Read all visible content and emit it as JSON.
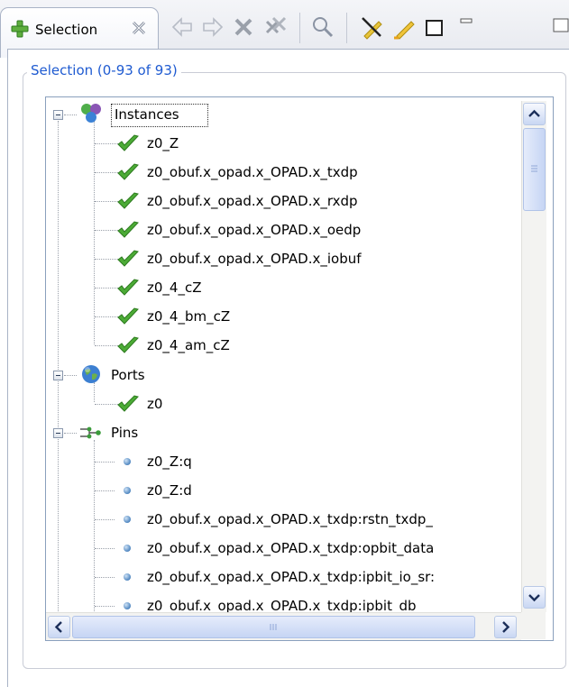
{
  "tab": {
    "title": "Selection"
  },
  "toolbar": {
    "buttons": [
      {
        "icon": "back-arrow-icon"
      },
      {
        "icon": "forward-arrow-icon"
      },
      {
        "icon": "delete-x-icon"
      },
      {
        "icon": "delete-all-icon"
      },
      {
        "icon": "search-icon"
      },
      {
        "icon": "clear-highlight-icon"
      },
      {
        "icon": "highlight-pen-icon"
      },
      {
        "icon": "rectangle-icon"
      },
      {
        "icon": "minimize-icon"
      }
    ]
  },
  "group": {
    "legend": "Selection (0-93 of 93)"
  },
  "tree": {
    "instances": {
      "label": "Instances",
      "children": [
        "z0_Z",
        "z0_obuf.x_opad.x_OPAD.x_txdp",
        "z0_obuf.x_opad.x_OPAD.x_rxdp",
        "z0_obuf.x_opad.x_OPAD.x_oedp",
        "z0_obuf.x_opad.x_OPAD.x_iobuf",
        "z0_4_cZ",
        "z0_4_bm_cZ",
        "z0_4_am_cZ"
      ]
    },
    "ports": {
      "label": "Ports",
      "children": [
        "z0"
      ]
    },
    "pins": {
      "label": "Pins",
      "children": [
        "z0_Z:q",
        "z0_Z:d",
        "z0_obuf.x_opad.x_OPAD.x_txdp:rstn_txdp_",
        "z0_obuf.x_opad.x_OPAD.x_txdp:opbit_data",
        "z0_obuf.x_opad.x_OPAD.x_txdp:ipbit_io_sr:",
        "z0_obuf.x_opad.x_OPAD.x_txdp:ipbit_db"
      ]
    }
  },
  "colors": {
    "legend": "#1f5bd1",
    "check": "#3f9c2c",
    "pin": "#4f86c0"
  }
}
